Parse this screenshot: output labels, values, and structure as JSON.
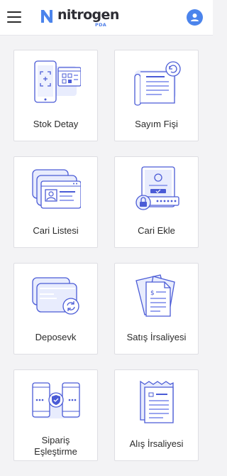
{
  "header": {
    "brand": "nitrogen",
    "brand_sub": "PDA",
    "colors": {
      "accent": "#4b84ec",
      "line": "#4a5bd6"
    }
  },
  "menu": [
    {
      "label": "Stok Detay",
      "icon": "phone-scan-icon"
    },
    {
      "label": "Sayım Fişi",
      "icon": "refresh-receipt-icon"
    },
    {
      "label": "Cari Listesi",
      "icon": "contact-card-icon"
    },
    {
      "label": "Cari Ekle",
      "icon": "secure-profile-icon"
    },
    {
      "label": "Deposevk",
      "icon": "card-transfer-icon"
    },
    {
      "label": "Satış İrsaliyesi",
      "icon": "dollar-documents-icon"
    },
    {
      "label": "Sipariş\nEşleştirme",
      "icon": "phone-match-icon"
    },
    {
      "label": "Alış İrsaliyesi",
      "icon": "receipt-icon"
    }
  ]
}
